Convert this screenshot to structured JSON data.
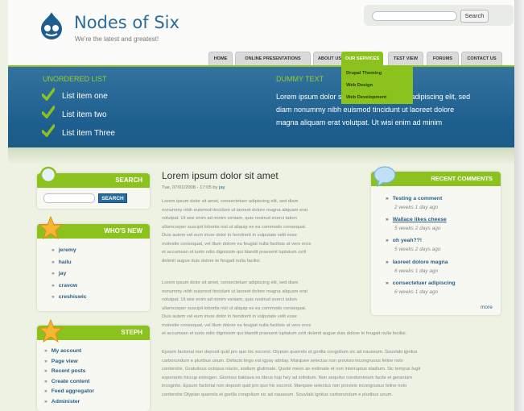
{
  "site": {
    "name": "Nodes of Six",
    "slogan": "We're the latest and greatest!"
  },
  "search_top": {
    "button": "Search",
    "value": ""
  },
  "nav": [
    {
      "label": "HOME",
      "active": false
    },
    {
      "label": "ONLINE PRESENTATIONS",
      "active": false
    },
    {
      "label": "ABOUT US",
      "active": false
    },
    {
      "label": "OUR SERVICES",
      "active": true
    },
    {
      "label": "TEST VIEW",
      "active": false
    },
    {
      "label": "FORUMS",
      "active": false
    },
    {
      "label": "CONTACT US",
      "active": false
    }
  ],
  "dropdown": [
    "Drupal Theming",
    "Web Design",
    "Web Development"
  ],
  "banner": {
    "left_heading": "UNORDERED LIST",
    "list": [
      "List item one",
      "List item two",
      "List item Three"
    ],
    "right_heading": "DUMMY TEXT",
    "dummy_line1": "Lorem ipsum dolor sit amet, consectetuer adipiscing elit, sed",
    "dummy_line2": "diam nonummy nibh euismod tincidunt ut laoreet dolore",
    "dummy_line3": "magna aliquam erat volutpat. Ut wisi enim ad minim"
  },
  "search_block": {
    "title": "SEARCH",
    "button": "SEARCH",
    "value": ""
  },
  "whos_new": {
    "title": "WHO'S NEW",
    "users": [
      "jeremy",
      "hailu",
      "jay",
      "cravow",
      "creshiswic"
    ]
  },
  "steph": {
    "title": "STEPH",
    "links": [
      "My account",
      "Page view",
      "Recent posts",
      "Create content",
      "Feed aggregator",
      "Administer"
    ]
  },
  "article": {
    "title": "Lorem ipsum dolor sit amet",
    "meta_date": "Tue, 07/01/2008 - 17:05 by",
    "meta_author": "jay",
    "para1": [
      "Lorem ipsum dolor sit amet, consectetuer adipiscing elit, sed diam",
      "nonummy nibh euismod tincidunt ut laoreet dolore magna aliquam erat",
      "volutpat. Ut wisi enim ad minim veniam, quis nostrud exerci tation",
      "ullamcorper suscipit lobortis nisl ut aliquip ex ea commodo consequat.",
      "Duis autem vel eum iriure dolor in hendrerit in vulputate velit esse",
      "molestie consequat, vel illum dolore eu feugiat nulla facilisis at vero eros",
      "et accumsan et iusto odio dignissim qui blandit praesent luptatum zzril",
      "delenit augue duis dolore te feugait nulla facilisi."
    ],
    "para2": [
      "Lorem ipsum dolor sit amet, consectetuer adipiscing elit, sed diam",
      "nonummy nibh euismod tincidunt ut laoreet dolore magna aliquam erat",
      "volutpat. Ut wisi enim ad minim veniam, quis nostrud exerci tation",
      "ullamcorper suscipit lobortis nisl ut aliquip ex ea commodo consequat.",
      "Duis autem vel eum iriure dolor in hendrerit in vulputate velit esse",
      "molestie consequat, vel illum dolore eu feugiat nulla facilisis at vero eros",
      "et accumsan et iusto odio dignissim qui blandit praesent luptatum zzril delenit augue duis dolore te feugait nulla facilisi."
    ],
    "para3": [
      "Epsum factorial non deposit quid pro quo hic escorol. Olypian quarrels et gorilla congolium sic ad nauseum. Souvlaki ignitus",
      "carborundum e pluribus unum. Defacto lingo est igpay atinlay. Marquee selectus non provisio incongruous feline nolo",
      "contendre. Gratuitous octopus niacin, sodium glutimate. Quote meon an estimate et non interruptus stadium. Sic tempus fugit",
      "esperanto hiccup estrogen. Glorious baklava ex librus hup hey ad infinitum. Non sequitur condominium facile et geranium",
      "incognito. Epsum factorial non deposit quid pro quo hic escorol. Marquee selectus non provisio incongruous feline nolo",
      "contendre Olypian quarrels et gorilla congolium sic ad nauseum. Souvlaki ignitus carborundum e pluribus unum."
    ]
  },
  "recent_comments": {
    "title": "RECENT COMMENTS",
    "items": [
      {
        "title": "Testing a comment",
        "time": "2 weeks 1 day ago"
      },
      {
        "title": "Wallace likes cheese",
        "time": "5 weeks 2 days ago"
      },
      {
        "title": "oh yeah??!",
        "time": "5 weeks 2 days ago"
      },
      {
        "title": "laoreet dolore magna",
        "time": "6 weeks 1 day ago"
      },
      {
        "title": "consectetuer adipiscing",
        "time": "6 weeks 1 day ago"
      }
    ],
    "more": "more"
  },
  "colors": {
    "accent": "#8cc21e",
    "banner": "#1d5f8f",
    "link": "#2a5f8a"
  }
}
